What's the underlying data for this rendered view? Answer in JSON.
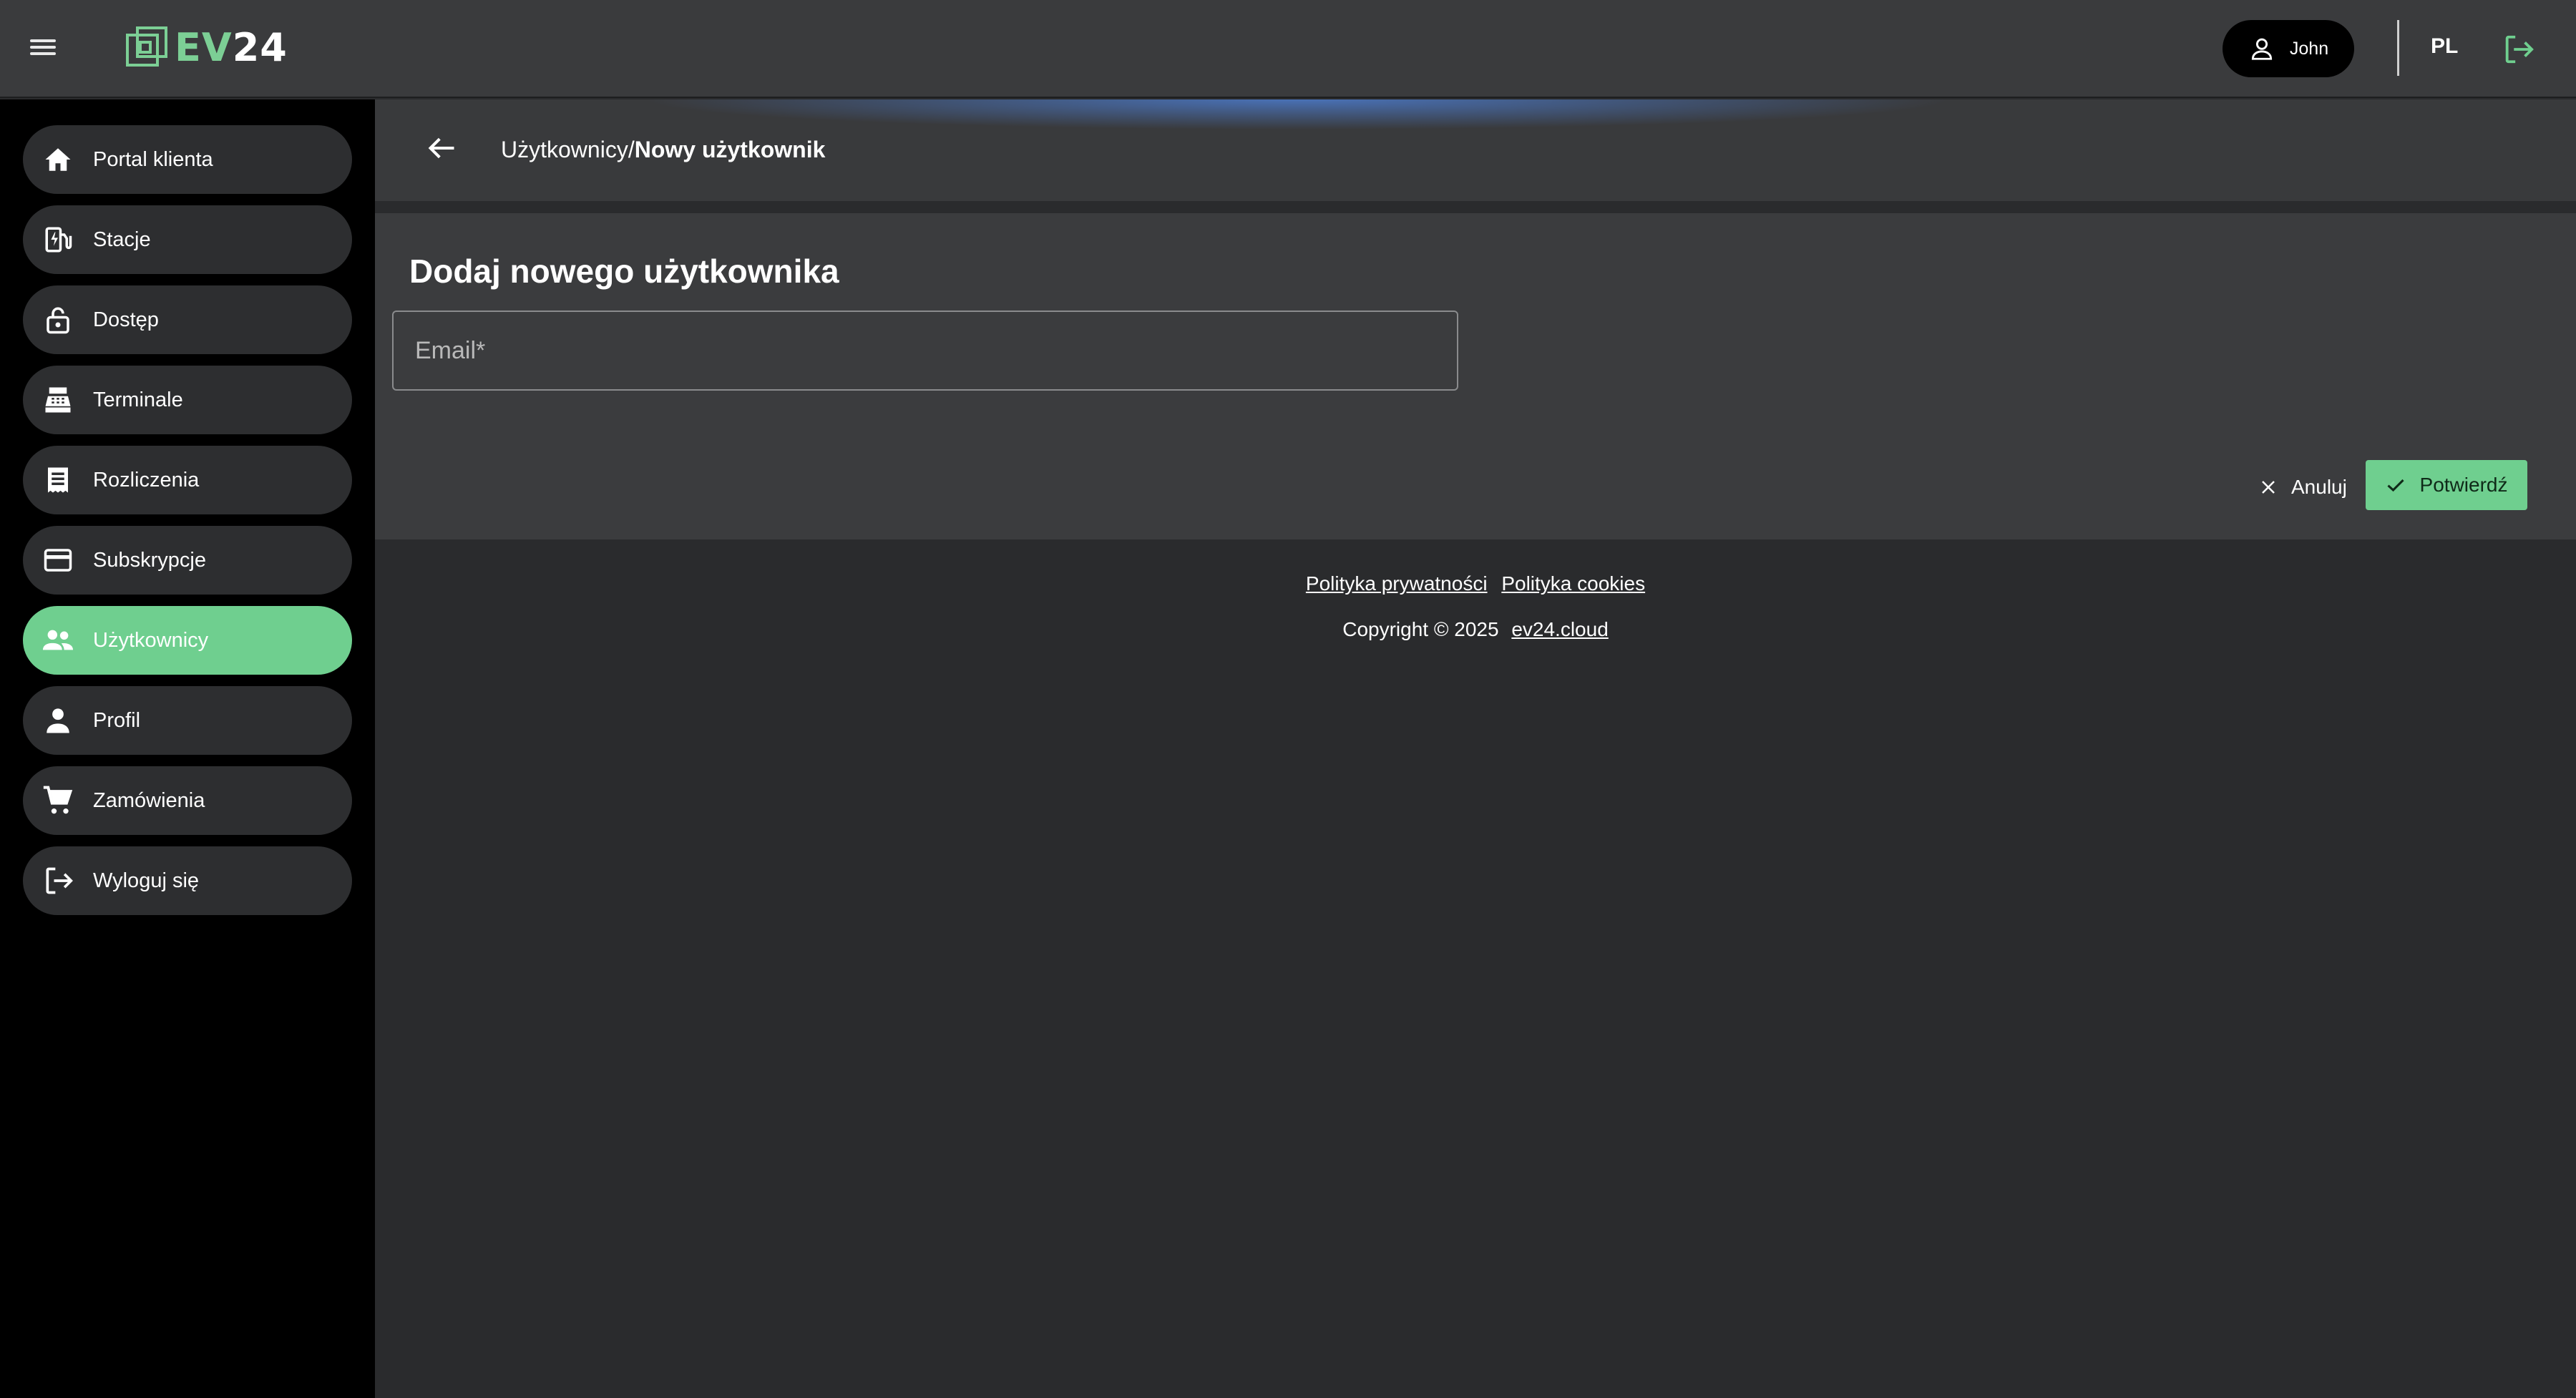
{
  "app": {
    "logo_prefix": "EV",
    "logo_suffix": "24"
  },
  "topbar": {
    "user_name": "John",
    "language": "PL"
  },
  "sidebar": {
    "items": [
      {
        "label": "Portal klienta",
        "icon": "home-icon"
      },
      {
        "label": "Stacje",
        "icon": "ev-station-icon"
      },
      {
        "label": "Dostęp",
        "icon": "lock-icon"
      },
      {
        "label": "Terminale",
        "icon": "terminal-icon"
      },
      {
        "label": "Rozliczenia",
        "icon": "receipt-icon"
      },
      {
        "label": "Subskrypcje",
        "icon": "credit-card-icon"
      },
      {
        "label": "Użytkownicy",
        "icon": "users-icon",
        "active": true
      },
      {
        "label": "Profil",
        "icon": "person-icon"
      },
      {
        "label": "Zamówienia",
        "icon": "cart-icon"
      },
      {
        "label": "Wyloguj się",
        "icon": "logout-icon"
      }
    ]
  },
  "breadcrumb": {
    "parent": "Użytkownicy/",
    "current": "Nowy użytkownik"
  },
  "form": {
    "title": "Dodaj nowego użytkownika",
    "email_placeholder": "Email*",
    "email_value": "",
    "cancel_label": "Anuluj",
    "confirm_label": "Potwierdź"
  },
  "footer": {
    "privacy_link": "Polityka prywatności",
    "cookies_link": "Polityka cookies",
    "copyright": "Copyright © 2025",
    "site_link": "ev24.cloud"
  },
  "colors": {
    "accent": "#6fcf8f",
    "topbar_bg": "#3a3b3d",
    "sidebar_bg": "#000000",
    "page_bg": "#2a2b2d",
    "card_bg": "#3b3c3e"
  }
}
